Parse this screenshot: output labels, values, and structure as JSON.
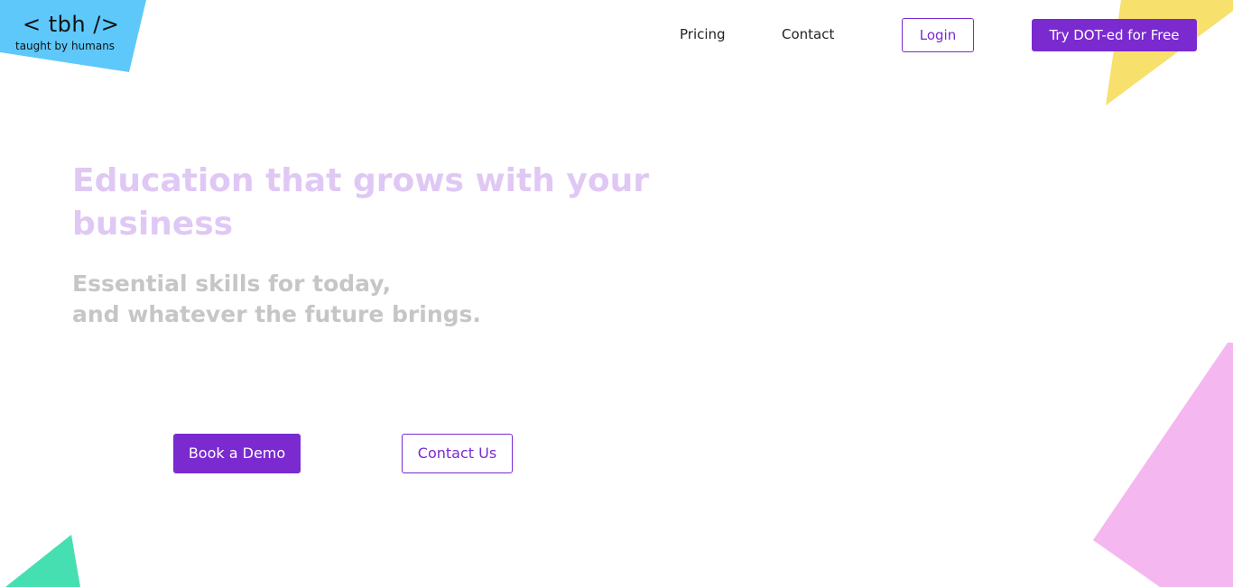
{
  "brand": {
    "logo_mark": "< tbh />",
    "tagline": "taught by humans"
  },
  "nav": {
    "pricing": "Pricing",
    "contact": "Contact",
    "login": "Login",
    "trial": "Try DOT-ed for Free"
  },
  "hero": {
    "title": "Education that grows with your business",
    "subtitle_line1": "Essential skills for today,",
    "subtitle_line2": "and whatever the future brings.",
    "demo_button": "Book a Demo",
    "contact_button": "Contact Us"
  },
  "icons": {
    "shape_blue": "decor-triangle-blue-icon",
    "shape_yellow": "decor-triangle-yellow-icon",
    "shape_pink": "decor-triangle-pink-icon",
    "shape_teal": "decor-triangle-teal-icon"
  },
  "colors": {
    "primary": "#7b2ad0",
    "title": "#e0c8f4",
    "subtitle": "#c6c6c6",
    "blue_shape": "#5ec8fb",
    "yellow_shape": "#f7e06c",
    "pink_shape": "#f5b7ef",
    "teal_shape": "#45dfb1"
  }
}
